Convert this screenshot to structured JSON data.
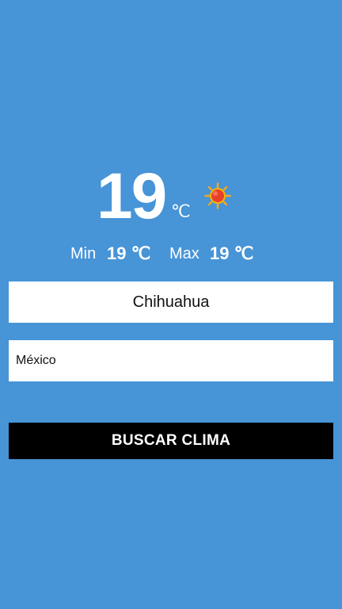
{
  "weather": {
    "temperature": "19",
    "unit": "℃",
    "icon": "sun-icon",
    "min_label": "Min",
    "min_value": "19 ℃",
    "max_label": "Max",
    "max_value": "19 ℃"
  },
  "form": {
    "city_value": "Chihuahua",
    "country_value": "México",
    "search_label": "BUSCAR CLIMA"
  },
  "colors": {
    "background": "#4794d7",
    "button": "#000000",
    "field": "#ffffff",
    "sun": "#e8412a",
    "sun_rays": "#f5a623"
  }
}
